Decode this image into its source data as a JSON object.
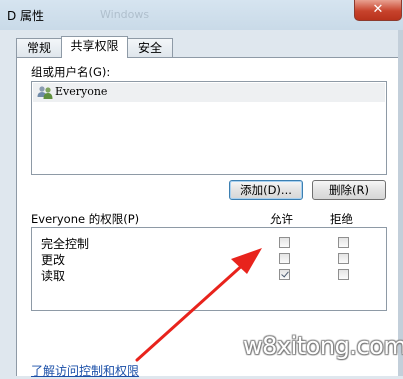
{
  "window": {
    "title": "D 属性",
    "close_label": "✕",
    "ghost_title": "Windows"
  },
  "tabs": [
    {
      "label": "常规"
    },
    {
      "label": "共享权限"
    },
    {
      "label": "安全"
    }
  ],
  "group_users": {
    "label": "组或用户名(G):",
    "items": [
      {
        "name": "Everyone",
        "icon": "users-icon"
      }
    ]
  },
  "buttons": {
    "add": "添加(D)...",
    "remove": "删除(R)"
  },
  "permissions": {
    "header": "Everyone 的权限(P)",
    "allow_label": "允许",
    "deny_label": "拒绝",
    "rows": [
      {
        "name": "完全控制",
        "allow": false,
        "deny": false
      },
      {
        "name": "更改",
        "allow": false,
        "deny": false
      },
      {
        "name": "读取",
        "allow": true,
        "deny": false
      }
    ]
  },
  "link": "了解访问控制和权限",
  "watermark": "w8xitong.com",
  "annotation": {
    "arrow_color": "#e8231c"
  }
}
